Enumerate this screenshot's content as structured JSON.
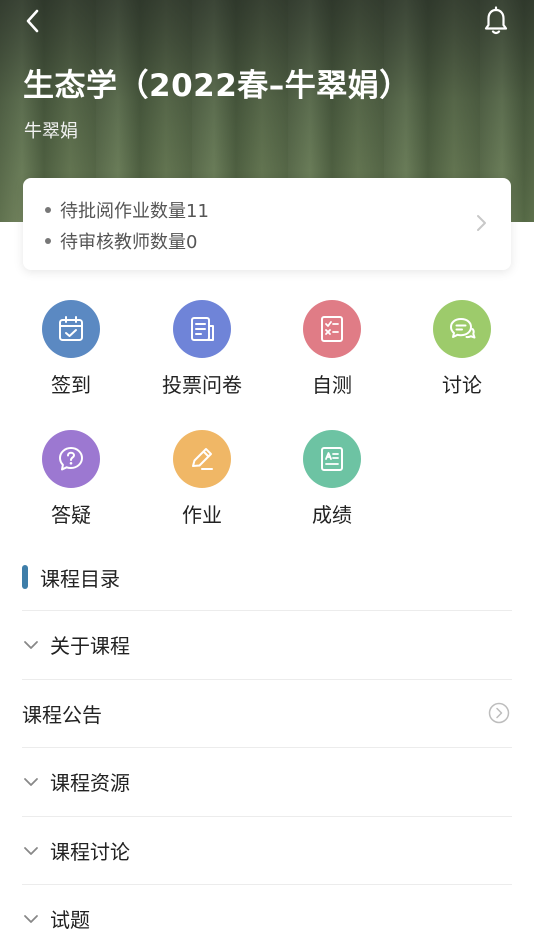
{
  "header": {
    "title": "生态学（2022春–牛翠娟）",
    "teacher": "牛翠娟"
  },
  "notice": {
    "items": [
      "待批阅作业数量11",
      "待审核教师数量0"
    ]
  },
  "features": [
    {
      "label": "签到",
      "icon": "calendar-check-icon",
      "color": "#5b89c2"
    },
    {
      "label": "投票问卷",
      "icon": "survey-icon",
      "color": "#6f84d8"
    },
    {
      "label": "自测",
      "icon": "quiz-icon",
      "color": "#e07c86"
    },
    {
      "label": "讨论",
      "icon": "chat-bubbles-icon",
      "color": "#9dcb6b"
    },
    {
      "label": "答疑",
      "icon": "question-bubble-icon",
      "color": "#9c78d1"
    },
    {
      "label": "作业",
      "icon": "pencil-icon",
      "color": "#f0b766"
    },
    {
      "label": "成绩",
      "icon": "grade-doc-icon",
      "color": "#6dc3a3"
    }
  ],
  "catalog": {
    "title": "课程目录",
    "rows": [
      {
        "label": "关于课程",
        "type": "expand"
      },
      {
        "label": "课程公告",
        "type": "link"
      },
      {
        "label": "课程资源",
        "type": "expand"
      },
      {
        "label": "课程讨论",
        "type": "expand"
      },
      {
        "label": "试题",
        "type": "expand"
      }
    ]
  }
}
